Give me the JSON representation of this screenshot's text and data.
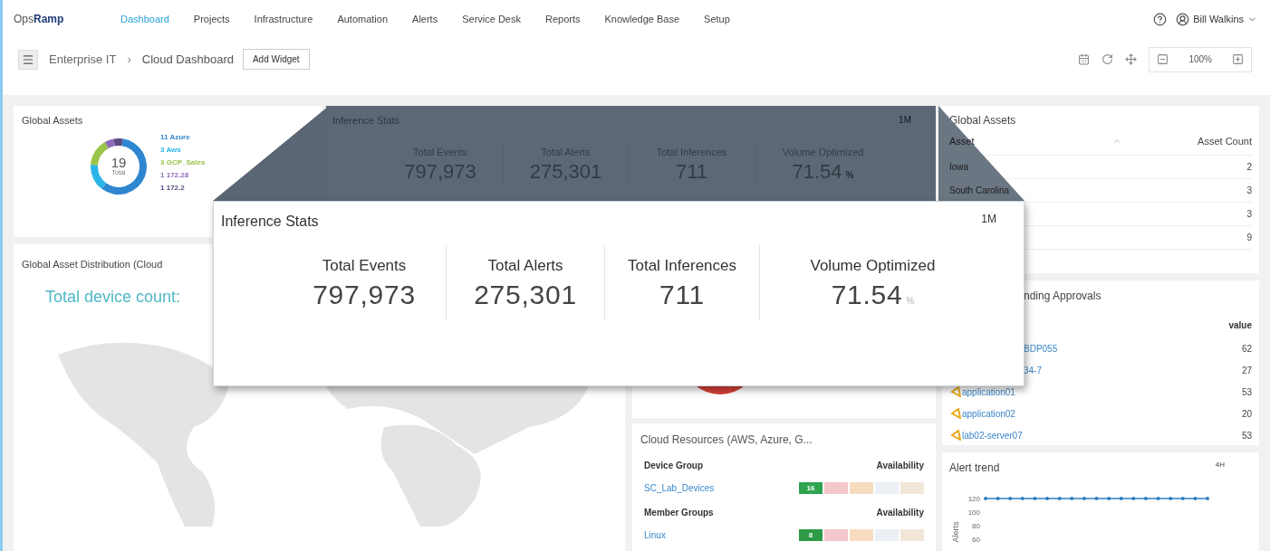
{
  "nav": {
    "logo": [
      "Ops",
      "Ramp"
    ],
    "items": [
      {
        "label": "Dashboard",
        "selected": true
      },
      {
        "label": "Projects",
        "selected": false
      },
      {
        "label": "Infrastructure",
        "selected": false
      },
      {
        "label": "Automation",
        "selected": false
      },
      {
        "label": "Alerts",
        "selected": false
      },
      {
        "label": "Service Desk",
        "selected": false
      },
      {
        "label": "Reports",
        "selected": false
      },
      {
        "label": "Knowledge Base",
        "selected": false
      },
      {
        "label": "Setup",
        "selected": false
      }
    ],
    "user": "Bill Walkins"
  },
  "toolbar": {
    "breadcrumb": [
      "Enterprise IT",
      "Cloud Dashboard"
    ],
    "separator": "›",
    "add_widget": "Add Widget",
    "zoom": "100%"
  },
  "global_assets_donut": {
    "title": "Global Assets",
    "total": "19",
    "total_label": "Total",
    "legend": [
      {
        "count": "11",
        "name": "Azure",
        "color": "#2f86d0"
      },
      {
        "count": "3",
        "name": "Aws",
        "color": "#2bb5e8"
      },
      {
        "count": "3",
        "name": "GCP_Sales",
        "color": "#9bc44a"
      },
      {
        "count": "1",
        "name": "172.28",
        "color": "#8e6bb8"
      },
      {
        "count": "1",
        "name": "172.2",
        "color": "#5a4a80"
      }
    ]
  },
  "inference_stats": {
    "title": "Inference Stats",
    "period": "1M",
    "stats": [
      {
        "label": "Total Events",
        "value": "797,973"
      },
      {
        "label": "Total Alerts",
        "value": "275,301"
      },
      {
        "label": "Total Inferences",
        "value": "711"
      },
      {
        "label": "Volume Optimized",
        "value": "71.54",
        "unit": "%"
      }
    ]
  },
  "inference_stats_zoomed": {
    "title": "Inference Stats",
    "period": "1M",
    "stats": [
      {
        "label": "Total Events",
        "value": "797,973"
      },
      {
        "label": "Total Alerts",
        "value": "275,301"
      },
      {
        "label": "Total Inferences",
        "value": "711"
      },
      {
        "label": "Volume Optimized",
        "value": "71.54",
        "unit": "%"
      }
    ]
  },
  "distribution": {
    "title": "Global Asset Distribution (Cloud",
    "count": "Total device count:"
  },
  "cloud_resources": {
    "title": "Cloud Resources (AWS, Azure, G...",
    "groups": [
      {
        "header": "Device Group",
        "availability": "Availability",
        "rows": [
          {
            "name": "SC_Lab_Devices",
            "badges": [
              {
                "text": "16",
                "color": "#2ea44f"
              },
              {
                "color": "#f4c7cc"
              },
              {
                "color": "#f7dcc0"
              },
              {
                "color": "#eceff3"
              },
              {
                "color": "#f2e6d8"
              }
            ]
          }
        ]
      },
      {
        "header": "Member Groups",
        "availability": "Availability",
        "rows": [
          {
            "name": "Linux",
            "badges": [
              {
                "text": "8",
                "color": "#2e9a45"
              },
              {
                "color": "#f4c7cc"
              },
              {
                "color": "#f7dcc0"
              },
              {
                "color": "#eceff3"
              },
              {
                "color": "#f2e6d8"
              }
            ]
          }
        ]
      }
    ]
  },
  "global_assets_table": {
    "title": "Global Assets",
    "columns": [
      "Asset",
      "Asset Count"
    ],
    "rows": [
      {
        "asset": "Iowa",
        "count": "2"
      },
      {
        "asset": "South Carolina",
        "count": "3"
      },
      {
        "count": "3"
      },
      {
        "count": "9"
      }
    ]
  },
  "pending_approvals": {
    "title": "nding Approvals",
    "value_header": "value",
    "rows": [
      {
        "name": "BDP055",
        "value": "62",
        "icon": false
      },
      {
        "name": "34-7",
        "value": "27",
        "icon": false
      },
      {
        "name": "application01",
        "value": "53",
        "icon": true
      },
      {
        "name": "application02",
        "value": "20",
        "icon": true
      },
      {
        "name": "lab02-server07",
        "value": "53",
        "icon": true
      }
    ]
  },
  "alert_trend": {
    "title": "Alert trend",
    "period": "4H",
    "chart_data": {
      "type": "line",
      "ylabel": "Alerts",
      "yticks": [
        60,
        80,
        100,
        120
      ],
      "ylim": [
        60,
        120
      ],
      "series": [
        {
          "color": "#2f7fc1",
          "values": [
            120,
            120,
            120,
            120,
            120,
            120,
            120,
            120,
            120,
            120,
            120,
            120,
            120,
            120,
            120,
            120,
            120,
            120,
            120
          ]
        }
      ]
    }
  }
}
